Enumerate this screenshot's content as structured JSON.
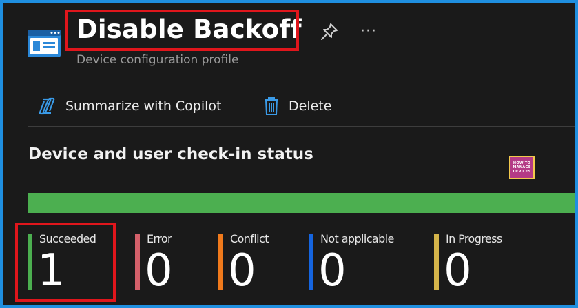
{
  "header": {
    "title": "Disable Backoff",
    "subtitle": "Device configuration profile",
    "more_label": "···"
  },
  "toolbar": {
    "copilot_label": "Summarize with Copilot",
    "delete_label": "Delete"
  },
  "section": {
    "title": "Device and user check-in status"
  },
  "logo": {
    "line1": "HOW TO",
    "line2": "MANAGE",
    "line3": "DEVICES"
  },
  "stats": [
    {
      "label": "Succeeded",
      "value": "1",
      "color": "#4caf50"
    },
    {
      "label": "Error",
      "value": "0",
      "color": "#d4606a"
    },
    {
      "label": "Conflict",
      "value": "0",
      "color": "#f07a1c"
    },
    {
      "label": "Not applicable",
      "value": "0",
      "color": "#1565e0"
    },
    {
      "label": "In Progress",
      "value": "0",
      "color": "#d4b44a"
    }
  ],
  "colors": {
    "accent": "#1f8fe0",
    "highlight": "#e0161c",
    "status_bar": "#4caf50",
    "background": "#1a1a1a"
  },
  "icons": {
    "profile": "profile-card-icon",
    "pin": "pin-icon",
    "copilot": "copilot-icon",
    "delete": "trash-icon"
  }
}
